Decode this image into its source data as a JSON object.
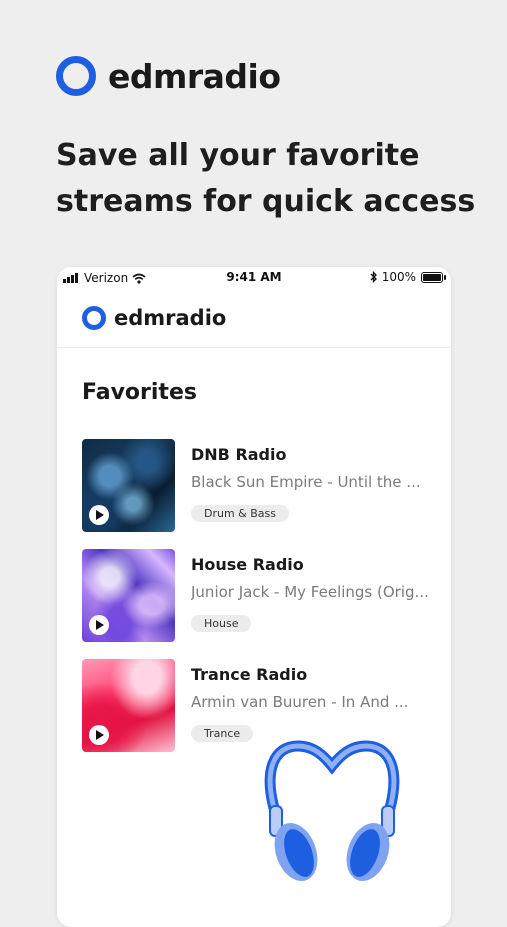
{
  "brand": {
    "name": "edmradio"
  },
  "headline": "Save all your favorite streams for quick access",
  "status_bar": {
    "carrier": "Verizon",
    "time": "9:41 AM",
    "battery": "100%"
  },
  "app": {
    "brand_name": "edmradio",
    "section_title": "Favorites",
    "favorites": [
      {
        "title": "DNB Radio",
        "track": "Black Sun Empire - Until the ...",
        "tag": "Drum & Bass"
      },
      {
        "title": "House Radio",
        "track": "Junior Jack - My Feelings (Orig...",
        "tag": "House"
      },
      {
        "title": "Trance Radio",
        "track": "Armin van Buuren - In And ...",
        "tag": "Trance"
      }
    ]
  },
  "colors": {
    "accent": "#1d5fe0",
    "background": "#eeeeef",
    "headphones_light": "#7fa3f0",
    "headphones_dark": "#1d5fe0"
  },
  "icons": [
    "logo-ring-icon",
    "signal-icon",
    "wifi-icon",
    "bluetooth-icon",
    "battery-icon",
    "play-icon",
    "headphones-icon"
  ]
}
